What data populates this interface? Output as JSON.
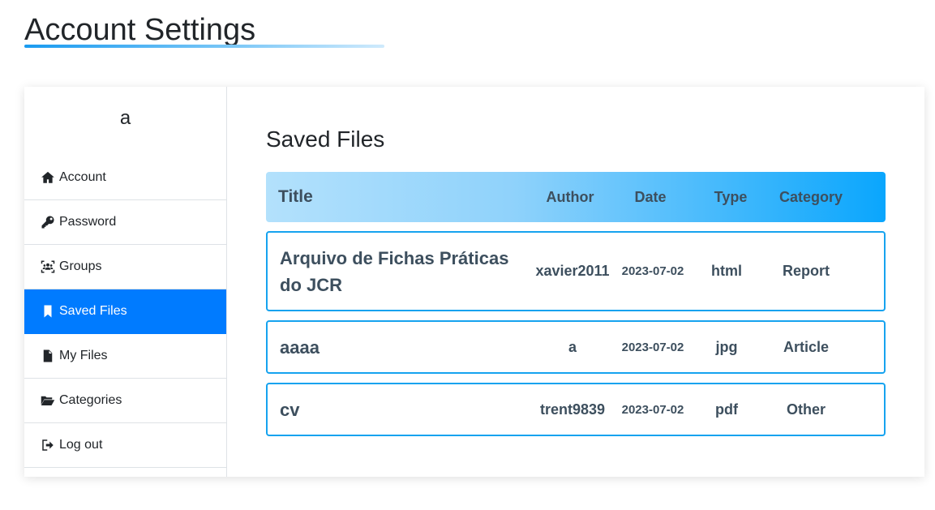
{
  "page": {
    "title": "Account Settings"
  },
  "sidebar": {
    "username": "a",
    "items": [
      {
        "label": "Account",
        "icon": "home-icon",
        "active": false
      },
      {
        "label": "Password",
        "icon": "key-icon",
        "active": false
      },
      {
        "label": "Groups",
        "icon": "users-icon",
        "active": false
      },
      {
        "label": "Saved Files",
        "icon": "bookmark-icon",
        "active": true
      },
      {
        "label": "My Files",
        "icon": "file-icon",
        "active": false
      },
      {
        "label": "Categories",
        "icon": "folder-open-icon",
        "active": false
      },
      {
        "label": "Log out",
        "icon": "sign-out-icon",
        "active": false
      }
    ]
  },
  "main": {
    "section_title": "Saved Files",
    "table": {
      "headers": {
        "title": "Title",
        "author": "Author",
        "date": "Date",
        "type": "Type",
        "category": "Category"
      },
      "rows": [
        {
          "title": "Arquivo de Fichas Práticas do JCR",
          "author": "xavier2011",
          "date": "2023-07-02",
          "type": "html",
          "category": "Report"
        },
        {
          "title": "aaaa",
          "author": "a",
          "date": "2023-07-02",
          "type": "jpg",
          "category": "Article"
        },
        {
          "title": "cv",
          "author": "trent9839",
          "date": "2023-07-02",
          "type": "pdf",
          "category": "Other"
        }
      ]
    }
  },
  "colors": {
    "accent": "#007bff",
    "row_border": "#16a3ef",
    "header_gradient_end": "#0aa6fd"
  }
}
